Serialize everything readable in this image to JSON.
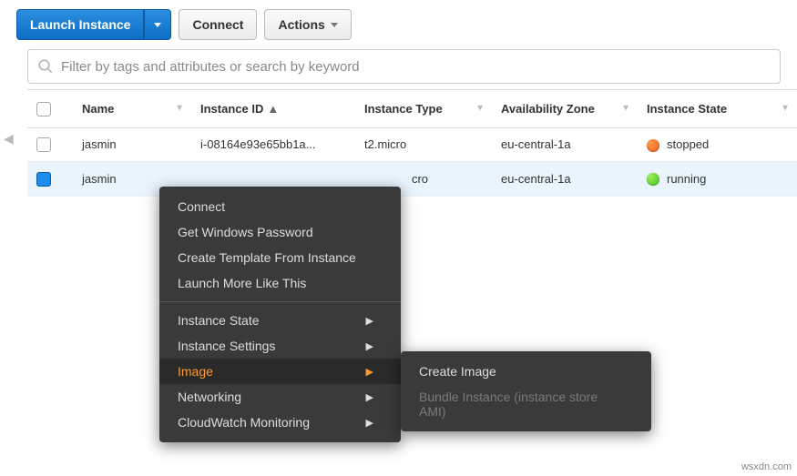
{
  "toolbar": {
    "launch_label": "Launch Instance",
    "connect_label": "Connect",
    "actions_label": "Actions"
  },
  "search": {
    "placeholder": "Filter by tags and attributes or search by keyword"
  },
  "columns": {
    "name": "Name",
    "instance_id": "Instance ID",
    "instance_type": "Instance Type",
    "availability_zone": "Availability Zone",
    "instance_state": "Instance State"
  },
  "rows": [
    {
      "name": "jasmin",
      "id": "i-08164e93e65bb1a...",
      "type": "t2.micro",
      "az": "eu-central-1a",
      "state": "stopped"
    },
    {
      "name": "jasmin",
      "id": "",
      "type": "cro",
      "az": "eu-central-1a",
      "state": "running"
    }
  ],
  "context_menu": {
    "items_top": [
      "Connect",
      "Get Windows Password",
      "Create Template From Instance",
      "Launch More Like This"
    ],
    "items_sub": [
      "Instance State",
      "Instance Settings",
      "Image",
      "Networking",
      "CloudWatch Monitoring"
    ],
    "submenu": {
      "create_image": "Create Image",
      "bundle_instance": "Bundle Instance (instance store AMI)"
    }
  },
  "watermark": "wsxdn.com"
}
